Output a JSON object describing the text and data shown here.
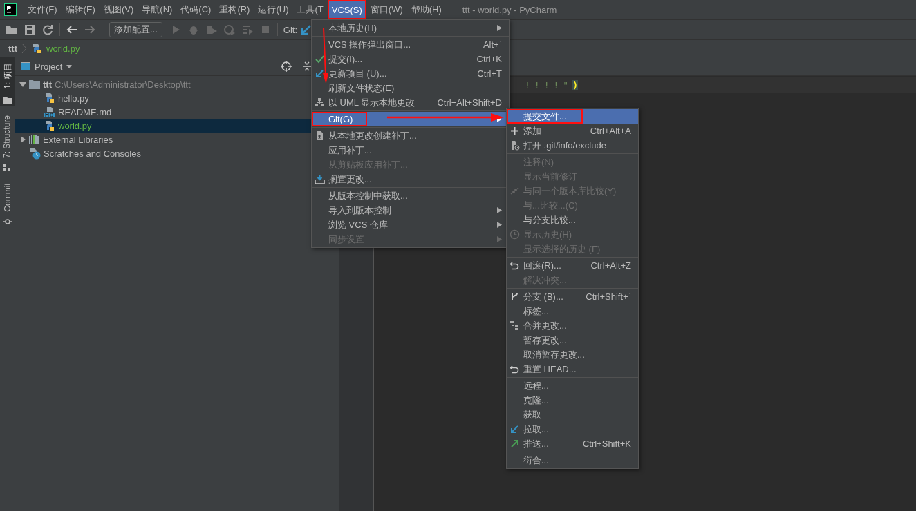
{
  "window": {
    "title": "ttt - world.py - PyCharm"
  },
  "menubar": [
    {
      "label": "文件(F)",
      "selected": false
    },
    {
      "label": "编辑(E)",
      "selected": false
    },
    {
      "label": "视图(V)",
      "selected": false
    },
    {
      "label": "导航(N)",
      "selected": false
    },
    {
      "label": "代码(C)",
      "selected": false
    },
    {
      "label": "重构(R)",
      "selected": false
    },
    {
      "label": "运行(U)",
      "selected": false
    },
    {
      "label": "工具(T",
      "selected": false
    },
    {
      "label": "VCS(S)",
      "selected": true,
      "highlighted": true
    },
    {
      "label": "窗口(W)",
      "selected": false
    },
    {
      "label": "帮助(H)",
      "selected": false
    }
  ],
  "toolbar": {
    "config_button": "添加配置...",
    "git_label": "Git:"
  },
  "breadcrumb": [
    "ttt",
    "world.py"
  ],
  "tool_window_tabs": [
    {
      "label": "1: 项目",
      "selected": true
    },
    {
      "label": "7: Structure",
      "selected": false
    },
    {
      "label": "Commit",
      "selected": false
    }
  ],
  "project_panel": {
    "title": "Project",
    "tree": [
      {
        "label": "ttt",
        "path": "C:\\Users\\Administrator\\Desktop\\ttt",
        "expanded": true,
        "selected": false,
        "children": [
          {
            "label": "hello.py",
            "selected": false
          },
          {
            "label": "README.md",
            "selected": false
          },
          {
            "label": "world.py",
            "selected": true
          }
        ]
      },
      {
        "label": "External Libraries",
        "expanded": false,
        "selected": false
      },
      {
        "label": "Scratches and Consoles",
        "selected": false
      }
    ]
  },
  "editor": {
    "code": "!!!!\"",
    "bracket": ")"
  },
  "vcs_menu": [
    {
      "kind": "item",
      "label": "本地历史(H)",
      "submenu": true,
      "disabled": false,
      "selected": false
    },
    {
      "kind": "separator"
    },
    {
      "kind": "item",
      "label": "VCS 操作弹出窗口...",
      "shortcut": "Alt+`",
      "disabled": false,
      "selected": false
    },
    {
      "kind": "item",
      "label": "提交(I)...",
      "shortcut": "Ctrl+K",
      "disabled": false,
      "selected": false
    },
    {
      "kind": "item",
      "label": "更新项目 (U)...",
      "shortcut": "Ctrl+T",
      "disabled": false,
      "selected": false
    },
    {
      "kind": "item",
      "label": "刷新文件状态(E)",
      "disabled": false,
      "selected": false
    },
    {
      "kind": "item",
      "label": "以 UML 显示本地更改",
      "shortcut": "Ctrl+Alt+Shift+D",
      "disabled": false,
      "selected": false
    },
    {
      "kind": "separator"
    },
    {
      "kind": "item",
      "label": "Git(G)",
      "submenu": true,
      "disabled": false,
      "selected": true,
      "highlighted": true
    },
    {
      "kind": "separator"
    },
    {
      "kind": "item",
      "label": "从本地更改创建补丁...",
      "disabled": false,
      "selected": false
    },
    {
      "kind": "item",
      "label": "应用补丁...",
      "disabled": false,
      "selected": false
    },
    {
      "kind": "item",
      "label": "从剪贴板应用补丁...",
      "disabled": true,
      "selected": false
    },
    {
      "kind": "item",
      "label": "搁置更改...",
      "disabled": false,
      "selected": false
    },
    {
      "kind": "separator"
    },
    {
      "kind": "item",
      "label": "从版本控制中获取...",
      "disabled": false,
      "selected": false
    },
    {
      "kind": "item",
      "label": "导入到版本控制",
      "submenu": true,
      "disabled": false,
      "selected": false
    },
    {
      "kind": "item",
      "label": "浏览 VCS 仓库",
      "submenu": true,
      "disabled": false,
      "selected": false
    },
    {
      "kind": "item",
      "label": "同步设置",
      "submenu": true,
      "disabled": true,
      "selected": false
    }
  ],
  "git_submenu": [
    {
      "kind": "item",
      "label": "提交文件...",
      "disabled": false,
      "selected": true,
      "highlighted": true
    },
    {
      "kind": "item",
      "label": "添加",
      "shortcut": "Ctrl+Alt+A",
      "disabled": false,
      "selected": false
    },
    {
      "kind": "item",
      "label": "打开 .git/info/exclude",
      "disabled": false,
      "selected": false
    },
    {
      "kind": "separator"
    },
    {
      "kind": "item",
      "label": "注释(N)",
      "disabled": true,
      "selected": false
    },
    {
      "kind": "item",
      "label": "显示当前修订",
      "disabled": true,
      "selected": false
    },
    {
      "kind": "item",
      "label": "与同一个版本库比较(Y)",
      "disabled": true,
      "selected": false
    },
    {
      "kind": "item",
      "label": "与...比较...(C)",
      "disabled": true,
      "selected": false
    },
    {
      "kind": "item",
      "label": "与分支比较...",
      "disabled": false,
      "selected": false
    },
    {
      "kind": "item",
      "label": "显示历史(H)",
      "disabled": true,
      "selected": false
    },
    {
      "kind": "item",
      "label": "显示选择的历史 (F)",
      "disabled": true,
      "selected": false
    },
    {
      "kind": "separator"
    },
    {
      "kind": "item",
      "label": "回滚(R)...",
      "shortcut": "Ctrl+Alt+Z",
      "disabled": false,
      "selected": false
    },
    {
      "kind": "item",
      "label": "解决冲突...",
      "disabled": true,
      "selected": false
    },
    {
      "kind": "separator"
    },
    {
      "kind": "item",
      "label": "分支 (B)...",
      "shortcut": "Ctrl+Shift+`",
      "disabled": false,
      "selected": false
    },
    {
      "kind": "item",
      "label": "标签...",
      "disabled": false,
      "selected": false
    },
    {
      "kind": "item",
      "label": "合并更改...",
      "disabled": false,
      "selected": false
    },
    {
      "kind": "item",
      "label": "暂存更改...",
      "disabled": false,
      "selected": false
    },
    {
      "kind": "item",
      "label": "取消暂存更改...",
      "disabled": false,
      "selected": false
    },
    {
      "kind": "item",
      "label": "重置 HEAD...",
      "disabled": false,
      "selected": false
    },
    {
      "kind": "separator"
    },
    {
      "kind": "item",
      "label": "远程...",
      "disabled": false,
      "selected": false
    },
    {
      "kind": "item",
      "label": "克隆...",
      "disabled": false,
      "selected": false
    },
    {
      "kind": "item",
      "label": "获取",
      "disabled": false,
      "selected": false
    },
    {
      "kind": "item",
      "label": "拉取...",
      "disabled": false,
      "selected": false
    },
    {
      "kind": "item",
      "label": "推送...",
      "shortcut": "Ctrl+Shift+K",
      "disabled": false,
      "selected": false
    },
    {
      "kind": "separator"
    },
    {
      "kind": "item",
      "label": "衍合...",
      "disabled": false,
      "selected": false
    }
  ]
}
